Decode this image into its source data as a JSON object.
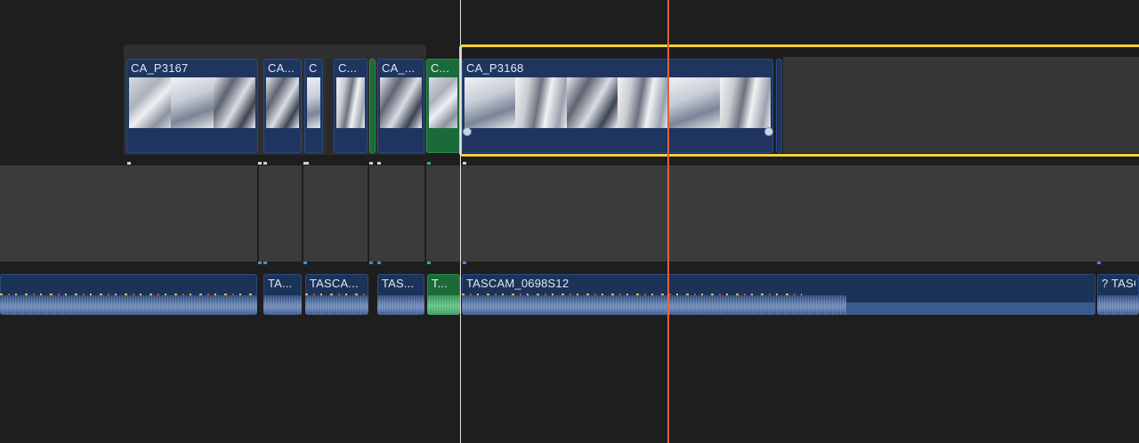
{
  "timeline": {
    "video_clips": [
      {
        "title": "CA_P3167"
      },
      {
        "title": "CA..."
      },
      {
        "title": "C"
      },
      {
        "title": "C..."
      },
      {
        "title": "CA_..."
      },
      {
        "title": "C..."
      },
      {
        "title": "CA_P3168"
      }
    ],
    "audio_clips": [
      {
        "title": "TA..."
      },
      {
        "title": "TASCA..."
      },
      {
        "title": "TAS..."
      },
      {
        "title": "T..."
      },
      {
        "title": "TASCAM_0698S12"
      },
      {
        "title": "? TASC"
      }
    ]
  },
  "colors": {
    "selection": "#f2d13a",
    "skimmer": "#e0613a",
    "clip_blue": "#1f3560",
    "clip_green": "#1b6a3c"
  }
}
